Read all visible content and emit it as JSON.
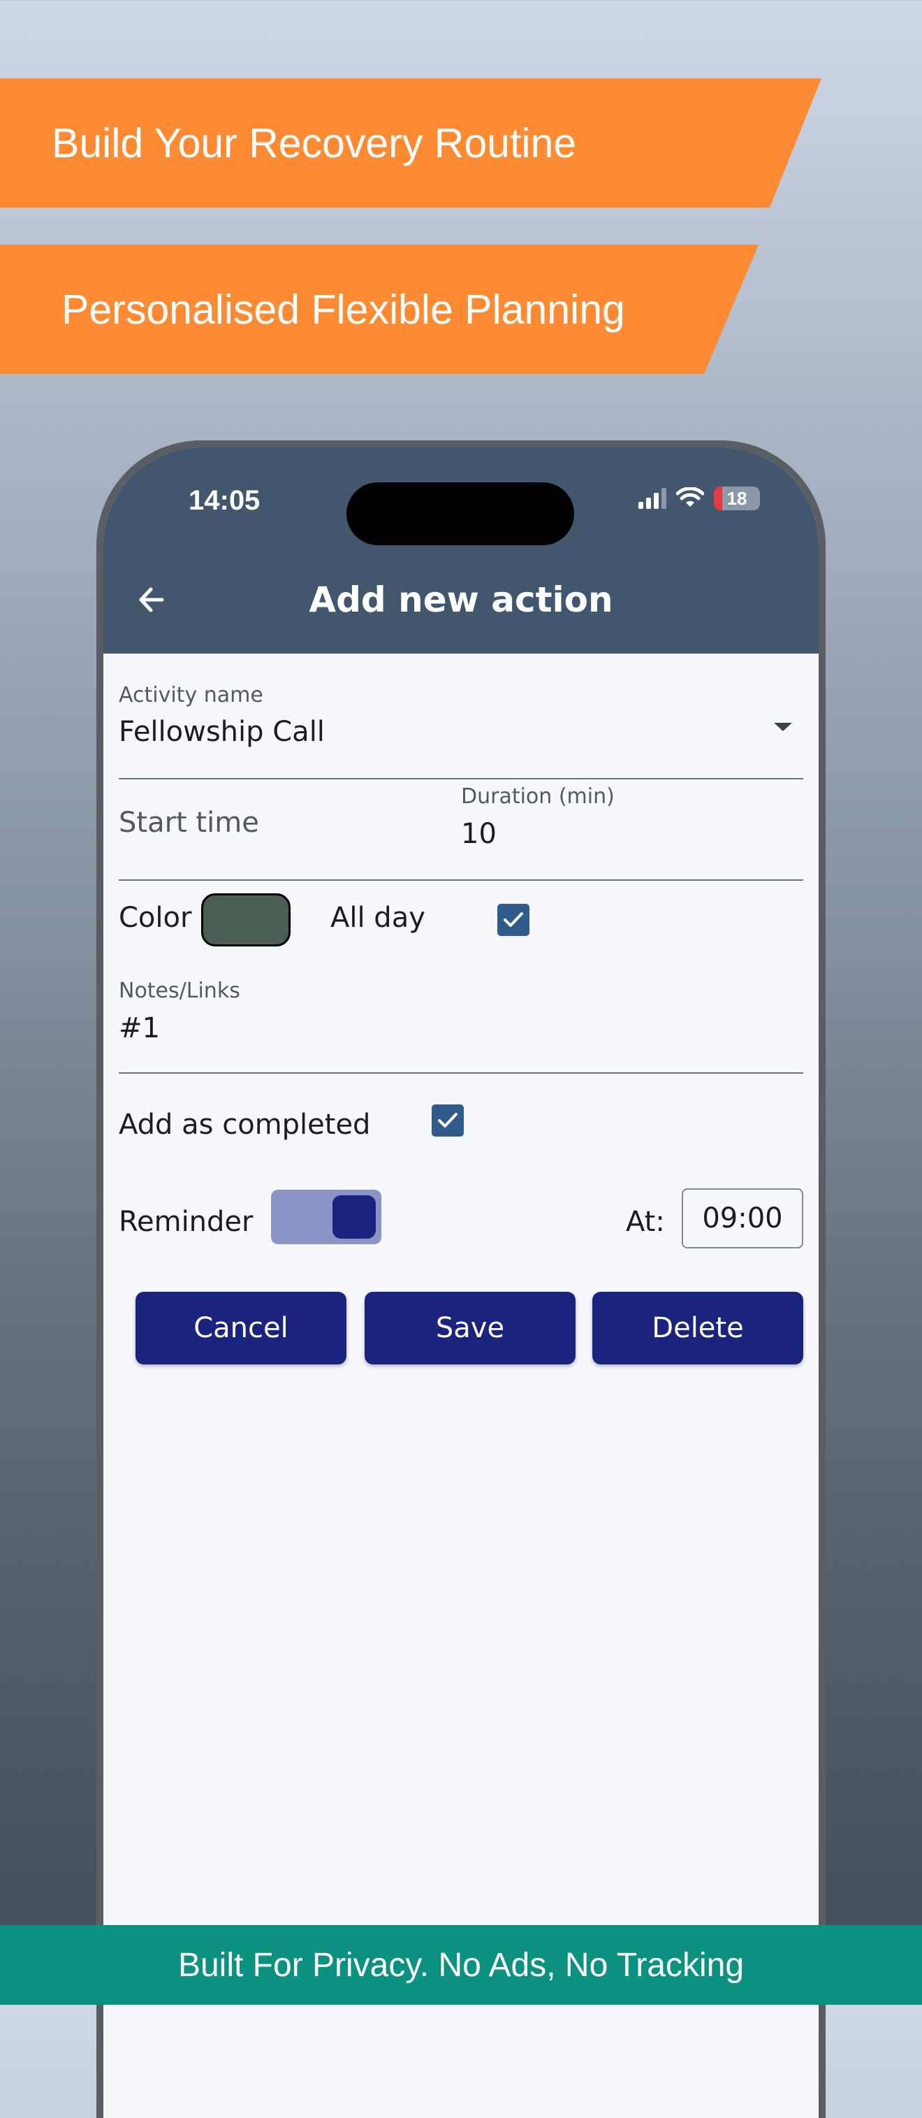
{
  "banners": {
    "headline1": "Build Your Recovery Routine",
    "headline2": "Personalised Flexible Planning"
  },
  "status_bar": {
    "time": "14:05",
    "battery_level": "18",
    "icons": [
      "signal-icon",
      "wifi-icon",
      "battery-icon"
    ]
  },
  "header": {
    "title": "Add new action",
    "back_icon": "arrow-left-icon"
  },
  "form": {
    "activity": {
      "label": "Activity name",
      "value": "Fellowship Call"
    },
    "start_time": {
      "label": "Start time"
    },
    "duration": {
      "label": "Duration (min)",
      "value": "10"
    },
    "color": {
      "label": "Color",
      "value": "#4b5e52"
    },
    "all_day": {
      "label": "All day",
      "checked": true
    },
    "notes": {
      "label": "Notes/Links",
      "value": "#1"
    },
    "completed": {
      "label": "Add as completed",
      "checked": true
    },
    "reminder": {
      "label": "Reminder",
      "enabled": true,
      "at_label": "At:",
      "time": "09:00"
    }
  },
  "buttons": {
    "cancel": "Cancel",
    "save": "Save",
    "delete": "Delete"
  },
  "footer": {
    "text": "Built For Privacy. No Ads, No Tracking"
  },
  "colors": {
    "accent_orange": "#fd8b33",
    "header_bg": "#42566d",
    "button_navy": "#1a237e",
    "checkbox_blue": "#315b8a",
    "footer_teal": "#0b917f"
  }
}
